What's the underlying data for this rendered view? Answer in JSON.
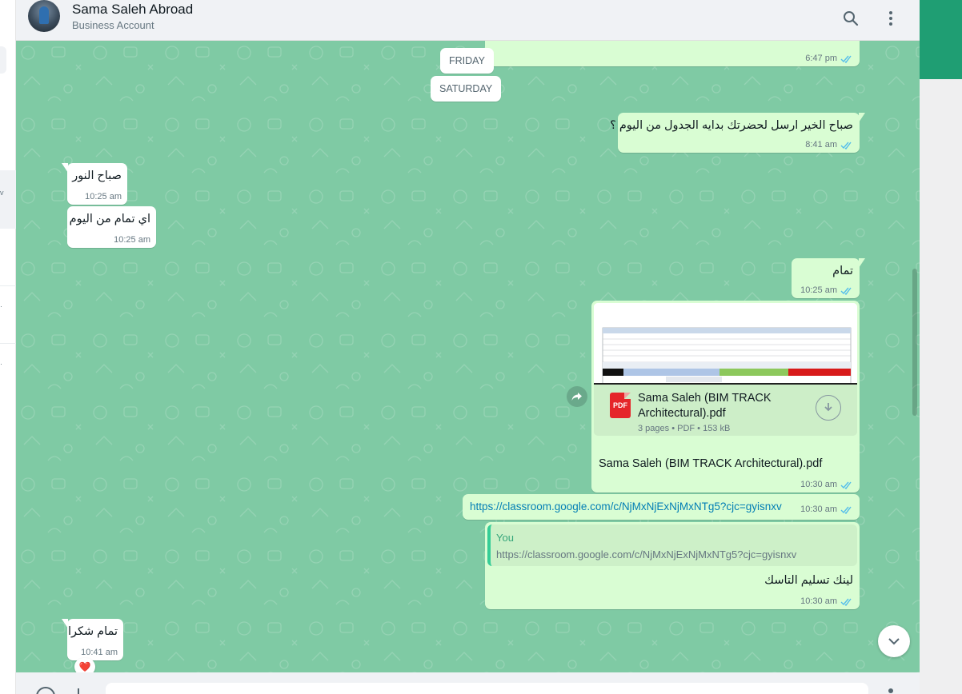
{
  "header": {
    "name": "Sama Saleh Abroad",
    "subtitle": "Business Account"
  },
  "sidebar_glyphs": [
    "v",
    "·",
    "·"
  ],
  "days": [
    "FRIDAY",
    "SATURDAY"
  ],
  "messages": {
    "top_partial": {
      "time": "6:47 pm"
    },
    "m1": {
      "text": "صباح الخير ارسل لحضرتك بدايه الجدول من اليوم ؟",
      "time": "8:41 am"
    },
    "m2": {
      "text": "صباح النور",
      "time": "10:25 am"
    },
    "m3": {
      "text": "اي تمام من اليوم",
      "time": "10:25 am"
    },
    "m4": {
      "text": "تمام",
      "time": "10:25 am"
    },
    "doc": {
      "file_name": "Sama Saleh (BIM TRACK Architectural).pdf",
      "file_type_badge": "PDF",
      "info": "3 pages • PDF • 153 kB",
      "caption": "Sama Saleh (BIM TRACK Architectural).pdf",
      "time": "10:30 am"
    },
    "link": {
      "text": "https://classroom.google.com/c/NjMxNjExNjMxNTg5?cjc=gyisnxv",
      "time": "10:30 am"
    },
    "reply": {
      "quote_author": "You",
      "quote_text": "https://classroom.google.com/c/NjMxNjExNjMxNTg5?cjc=gyisnxv",
      "text": "لينك تسليم التاسك",
      "time": "10:30 am"
    },
    "last": {
      "text": "تمام شكرا",
      "time": "10:41 am",
      "reaction": "❤️"
    }
  },
  "colors": {
    "chat_bg": "#7fcaa4",
    "outgoing": "#d9fdd3",
    "incoming": "#ffffff",
    "tick_blue": "#53bdeb",
    "link": "#027eb5"
  }
}
